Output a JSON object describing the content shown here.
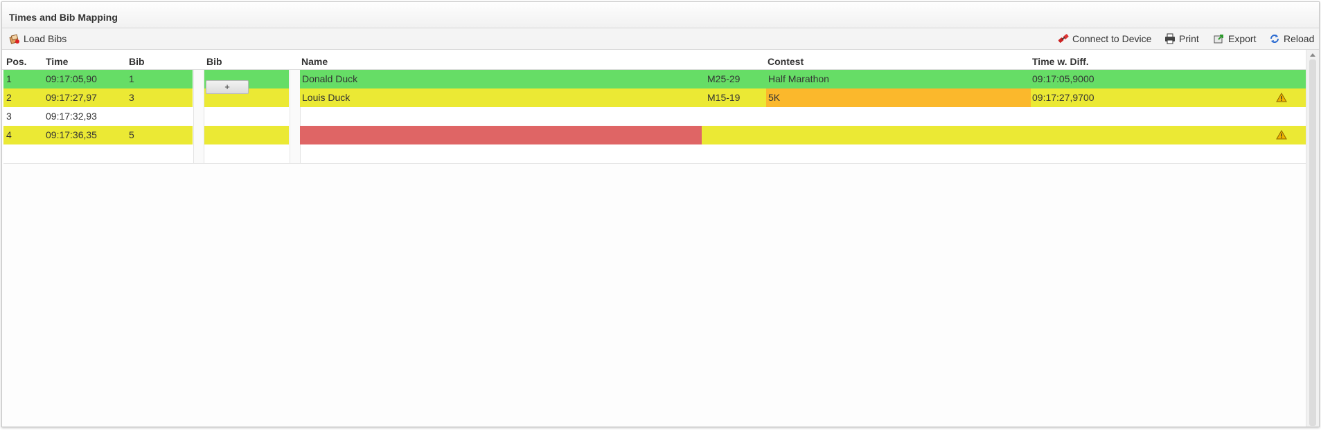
{
  "panel": {
    "title": "Times and Bib Mapping"
  },
  "toolbar": {
    "load_bibs": "Load Bibs",
    "connect": "Connect to Device",
    "print": "Print",
    "export": "Export",
    "reload": "Reload"
  },
  "columns": {
    "pos": "Pos.",
    "time": "Time",
    "bib": "Bib",
    "bib2": "Bib",
    "name": "Name",
    "contest": "Contest",
    "time_diff": "Time w. Diff."
  },
  "rows": [
    {
      "pos": "1",
      "time": "09:17:05,90",
      "bib": "1",
      "name": "Donald Duck",
      "agegroup": "M25-29",
      "contest": "Half Marathon",
      "time_diff": "09:17:05,9000",
      "status": "ok",
      "warning": false
    },
    {
      "pos": "2",
      "time": "09:17:27,97",
      "bib": "3",
      "name": "Louis Duck",
      "agegroup": "M15-19",
      "contest": "5K",
      "time_diff": "09:17:27,9700",
      "status": "warn",
      "warning": true
    },
    {
      "pos": "3",
      "time": "09:17:32,93",
      "bib": "",
      "name": "",
      "agegroup": "",
      "contest": "",
      "time_diff": "",
      "status": "none",
      "warning": false
    },
    {
      "pos": "4",
      "time": "09:17:36,35",
      "bib": "5",
      "name": "",
      "agegroup": "",
      "contest": "",
      "time_diff": "",
      "status": "warn",
      "warning": true
    }
  ],
  "add_button": "+",
  "colors": {
    "ok_green": "#66dd66",
    "warn_yellow": "#ebe934",
    "contest_orange": "#fbb82c",
    "error_red": "#df6565",
    "warning_icon": "#f0b400"
  },
  "icons": {
    "load_bibs": "load-bibs-icon",
    "connect": "plug-icon",
    "print": "printer-icon",
    "export": "export-icon",
    "reload": "reload-icon",
    "warning": "warning-icon"
  }
}
